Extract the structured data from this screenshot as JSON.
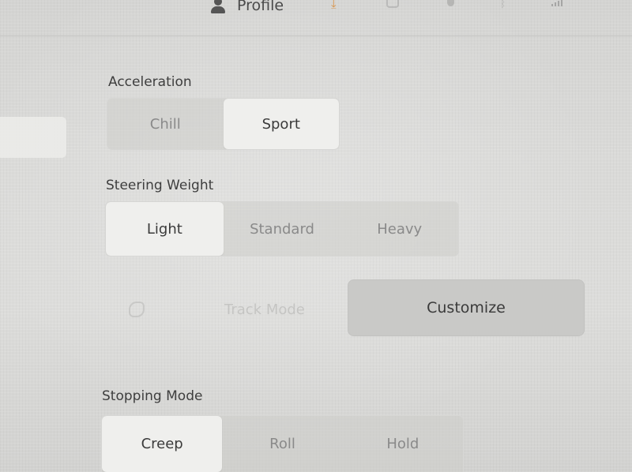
{
  "header": {
    "profile_label": "Profile",
    "icons": [
      "profile-icon",
      "download-icon",
      "camera-icon",
      "bell-icon",
      "bluetooth-icon",
      "signal-icon"
    ],
    "accent_color": "#d8944a"
  },
  "acceleration": {
    "label": "Acceleration",
    "options": [
      "Chill",
      "Sport"
    ],
    "selected": "Sport"
  },
  "steering_weight": {
    "label": "Steering Weight",
    "options": [
      "Light",
      "Standard",
      "Heavy"
    ],
    "selected": "Light"
  },
  "track_mode": {
    "label": "Track Mode",
    "icon": "track-icon",
    "enabled": false
  },
  "customize": {
    "label": "Customize"
  },
  "stopping_mode": {
    "label": "Stopping Mode",
    "options": [
      "Creep",
      "Roll",
      "Hold"
    ],
    "selected": "Creep"
  }
}
